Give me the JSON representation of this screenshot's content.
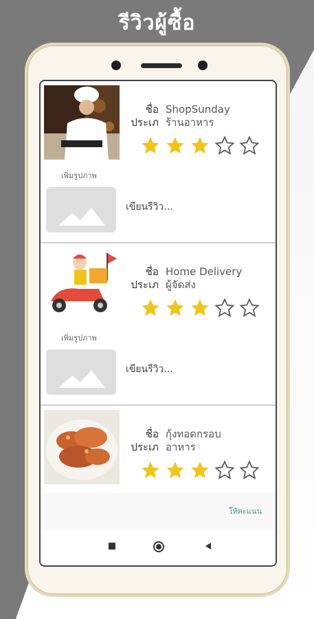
{
  "header": {
    "title": "รีวิวผู้ซื้อ"
  },
  "labels": {
    "name": "ชื่อ",
    "type": "ประเภ",
    "add_photo": "เพิ่มรูปภาพ",
    "write_review": "เขียนรีวิว..."
  },
  "reviews": [
    {
      "name": "ShopSunday",
      "type": "ร้านอาหาร",
      "rating": 3,
      "max_rating": 5,
      "image_icon": "chef-photo"
    },
    {
      "name": "Home Delivery",
      "type": "ผู้จัดส่ง",
      "rating": 3,
      "max_rating": 5,
      "image_icon": "delivery-scooter-illustration"
    },
    {
      "name": "กุ้งทอดกรอบ",
      "type": "อาหาร",
      "rating": 3,
      "max_rating": 5,
      "image_icon": "fried-shrimp-photo"
    }
  ],
  "footer": {
    "submit_label": "ให้คะแนน"
  },
  "colors": {
    "star_filled": "#f0c419",
    "accent": "#3a9d90"
  }
}
